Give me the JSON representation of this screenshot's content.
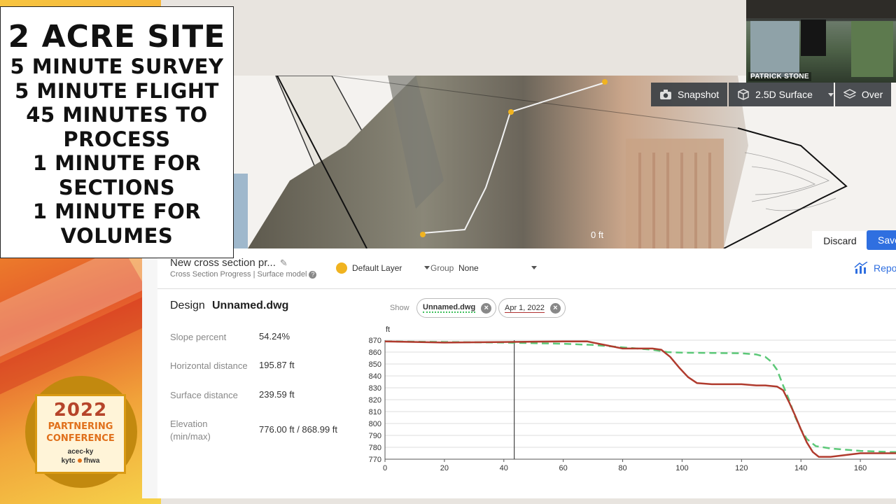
{
  "headline": {
    "lines": [
      "2 ACRE SITE",
      "5 MINUTE SURVEY",
      "5 MINUTE FLIGHT",
      "45 MINUTES TO",
      "PROCESS",
      "1 MINUTE FOR",
      "SECTIONS",
      "1 MINUTE FOR",
      "VOLUMES"
    ]
  },
  "webcam": {
    "name": "PATRICK STONE"
  },
  "viewport": {
    "zero_label": "0 ft",
    "toolbar": {
      "snapshot": "Snapshot",
      "surface": "2.5D Surface",
      "overlay": "Over"
    },
    "discard": "Discard",
    "save": "Save"
  },
  "panel": {
    "title": "New cross section pr...",
    "subtitle": "Cross Section Progress | Surface model",
    "layer": "Default Layer",
    "layer_color": "#f0b320",
    "group_label": "Group",
    "group_value": "None",
    "report": "Repo",
    "design_label": "Design",
    "design_value": "Unnamed.dwg",
    "stats": [
      {
        "key": "Slope percent",
        "value": "54.24%"
      },
      {
        "key": "Horizontal distance",
        "value": "195.87 ft"
      },
      {
        "key": "Surface distance",
        "value": "239.59 ft"
      },
      {
        "key": "Elevation",
        "key2": "(min/max)",
        "value": "776.00 ft / 868.99 ft"
      }
    ],
    "show_label": "Show",
    "chips": [
      "Unnamed.dwg",
      "Apr 1, 2022"
    ]
  },
  "chart_data": {
    "type": "line",
    "ylabel": "ft",
    "ylim": [
      770,
      870
    ],
    "xlim": [
      0,
      172
    ],
    "yticks": [
      870,
      860,
      850,
      840,
      830,
      820,
      810,
      800,
      790,
      780,
      770
    ],
    "xticks": [
      0,
      20,
      40,
      60,
      80,
      100,
      120,
      140,
      160
    ],
    "cursor_x": 43.5,
    "series": [
      {
        "color": "#5cc878",
        "style": "dashed",
        "x": [
          0,
          20,
          40,
          60,
          70,
          80,
          90,
          95,
          100,
          110,
          120,
          125,
          128,
          130,
          132,
          134,
          136,
          138,
          140,
          142,
          145,
          150,
          160,
          170,
          172
        ],
        "y": [
          869,
          868.5,
          868,
          867,
          866,
          864,
          862,
          860,
          859.5,
          859.3,
          859,
          858,
          856,
          852,
          845,
          832,
          820,
          806,
          795,
          787,
          781,
          779,
          777,
          776,
          776
        ]
      },
      {
        "color": "#b03b2e",
        "style": "solid",
        "x": [
          0,
          20,
          40,
          60,
          68,
          72,
          76,
          80,
          90,
          93,
          96,
          99,
          102,
          105,
          110,
          120,
          125,
          128,
          132,
          134,
          136,
          138,
          140,
          142,
          144,
          146,
          150,
          160,
          172
        ],
        "y": [
          869,
          868,
          868.5,
          869,
          869,
          867,
          865,
          863,
          863,
          862,
          856,
          847,
          839,
          834,
          833,
          833,
          832,
          832,
          831,
          828,
          818,
          807,
          795,
          784,
          776,
          772,
          772,
          775,
          775
        ]
      }
    ]
  },
  "logo": {
    "year": "2022",
    "line1": "PARTNERING",
    "line2": "CONFERENCE",
    "line3": "acec-ky",
    "line4a": "kytc",
    "line4b": "fhwa"
  }
}
